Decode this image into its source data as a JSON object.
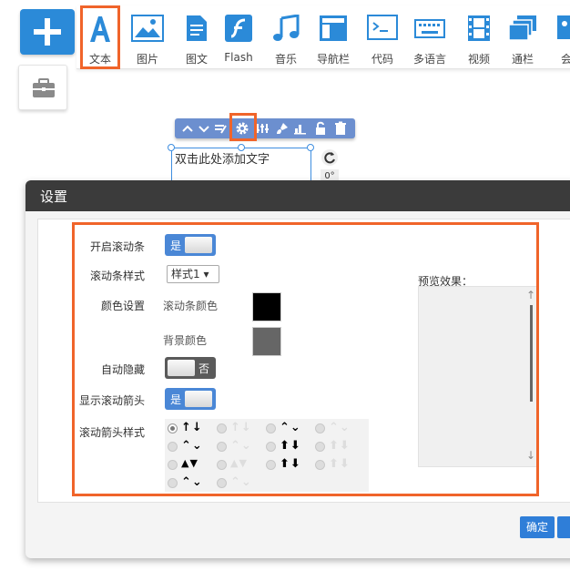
{
  "toolbar": {
    "tools": [
      {
        "label": "文本",
        "icon": "text-icon"
      },
      {
        "label": "图片",
        "icon": "image-icon"
      },
      {
        "label": "图文",
        "icon": "document-icon"
      },
      {
        "label": "Flash",
        "icon": "flash-icon"
      },
      {
        "label": "音乐",
        "icon": "music-icon"
      },
      {
        "label": "导航栏",
        "icon": "navbar-icon"
      },
      {
        "label": "代码",
        "icon": "code-icon"
      },
      {
        "label": "多语言",
        "icon": "keyboard-icon"
      },
      {
        "label": "视频",
        "icon": "video-icon"
      },
      {
        "label": "通栏",
        "icon": "layers-icon"
      },
      {
        "label": "会",
        "icon": "member-icon"
      }
    ]
  },
  "element_toolbar": {
    "icons": [
      "up-icon",
      "down-icon",
      "edit-icon",
      "gear-icon",
      "sliders-icon",
      "brush-icon",
      "chart-icon",
      "unlock-icon",
      "trash-icon"
    ]
  },
  "canvas": {
    "textbox_placeholder": "双击此处添加文字",
    "rotation_readout": "0°"
  },
  "dialog": {
    "title": "设置",
    "settings": {
      "enable_scrollbar": {
        "label": "开启滚动条",
        "state": "是",
        "on": true
      },
      "scrollbar_style": {
        "label": "滚动条样式",
        "value": "样式1 ▾"
      },
      "color_settings": {
        "label": "颜色设置",
        "scrollbar_color_label": "滚动条颜色",
        "scrollbar_color": "#000000",
        "background_color_label": "背景颜色",
        "background_color": "#666666"
      },
      "auto_hide": {
        "label": "自动隐藏",
        "state": "否",
        "on": false
      },
      "show_arrows": {
        "label": "显示滚动箭头",
        "state": "是",
        "on": true
      },
      "arrow_style": {
        "label": "滚动箭头样式",
        "options": [
          {
            "glyph": "↑↓",
            "color": "#000000",
            "selected": true
          },
          {
            "glyph": "↑↓",
            "color": "#dddddd",
            "selected": false
          },
          {
            "glyph": "⌃⌄",
            "color": "#000000",
            "selected": false
          },
          {
            "glyph": "⌃⌄",
            "color": "#dddddd",
            "selected": false
          },
          {
            "glyph": "⌃⌄",
            "color": "#000000",
            "selected": false
          },
          {
            "glyph": "⌃⌄",
            "color": "#dddddd",
            "selected": false
          },
          {
            "glyph": "⬆⬇",
            "color": "#000000",
            "selected": false
          },
          {
            "glyph": "⬆⬇",
            "color": "#dddddd",
            "selected": false
          },
          {
            "glyph": "▲▼",
            "color": "#000000",
            "selected": false
          },
          {
            "glyph": "▲▼",
            "color": "#dddddd",
            "selected": false
          },
          {
            "glyph": "⬆⬇",
            "color": "#000000",
            "selected": false
          },
          {
            "glyph": "⬆⬇",
            "color": "#dddddd",
            "selected": false
          },
          {
            "glyph": "⌃⌄",
            "color": "#000000",
            "selected": false
          },
          {
            "glyph": "⌃⌄",
            "color": "#dddddd",
            "selected": false
          }
        ]
      }
    },
    "preview_label": "预览效果：",
    "confirm_button": "确定"
  }
}
